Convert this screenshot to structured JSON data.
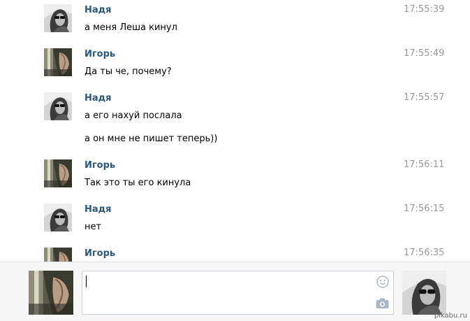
{
  "messages": [
    {
      "sender": "Надя",
      "time": "17:55:39",
      "avatar": "nadya",
      "lines": [
        "а меня Леша кинул"
      ]
    },
    {
      "sender": "Игорь",
      "time": "17:55:49",
      "avatar": "igor",
      "lines": [
        "Да ты че, почему?"
      ]
    },
    {
      "sender": "Надя",
      "time": "17:55:57",
      "avatar": "nadya",
      "lines": [
        "а его нахуй послала",
        "а он мне не пишет теперь))"
      ]
    },
    {
      "sender": "Игорь",
      "time": "17:56:11",
      "avatar": "igor",
      "lines": [
        "Так это ты его кинула"
      ]
    },
    {
      "sender": "Надя",
      "time": "17:56:15",
      "avatar": "nadya",
      "lines": [
        "нет"
      ]
    },
    {
      "sender": "Игорь",
      "time": "17:56:35",
      "avatar": "igor",
      "lines": []
    }
  ],
  "compose": {
    "value": "",
    "icons": [
      "emoji-icon",
      "camera-icon"
    ]
  },
  "watermark": "pikabu.ru",
  "colors": {
    "sender": "#2b587a",
    "time": "#999999",
    "compose_bg": "#f7f7f7",
    "input_border": "#c5d0db"
  }
}
